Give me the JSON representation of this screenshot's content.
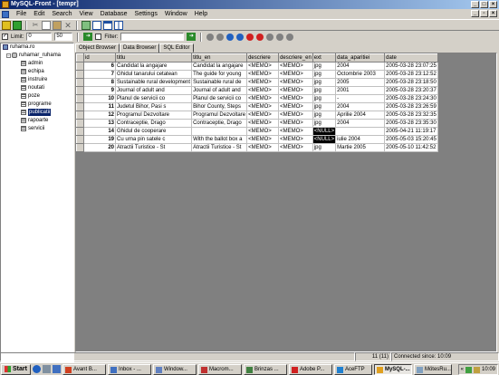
{
  "window": {
    "title": "MySQL-Front - [tempr]"
  },
  "menu": [
    "File",
    "Edit",
    "Search",
    "View",
    "Database",
    "Settings",
    "Window",
    "Help"
  ],
  "toolbar2": {
    "limit_label": "Limit:",
    "limit_from": "0",
    "limit_count": "50",
    "filter_label": "Filter:",
    "filter_value": ""
  },
  "tree": {
    "server": "ruhama.ro",
    "database": "ruhamar_ruhama",
    "tables": [
      "admin",
      "echipa",
      "instruire",
      "noutati",
      "poze",
      "programe",
      "publicatii",
      "rapoarte",
      "servicii"
    ],
    "selected": "publicatii"
  },
  "tabs": [
    "Object Browser",
    "Data Browser",
    "SQL Editor"
  ],
  "grid": {
    "columns": [
      "id",
      "titlu",
      "titlu_en",
      "descriere",
      "descriere_en",
      "ext",
      "data_aparitiei",
      "date"
    ],
    "rows": [
      [
        "6",
        "Candidat la angajare",
        "Candidat la angajare",
        "<MEMO>",
        "<MEMO>",
        "jpg",
        "2004",
        "2005-03-28 23:07:25"
      ],
      [
        "7",
        "Ghidul tanarului cetatean",
        "The guide for young",
        "<MEMO>",
        "<MEMO>",
        "jpg",
        "Octombrie 2003",
        "2005-03-28 23:12:52"
      ],
      [
        "8",
        "Sustainable rural development",
        "Sustainable rural de",
        "<MEMO>",
        "<MEMO>",
        "jpg",
        "2005",
        "2005-03-28 23:18:50"
      ],
      [
        "9",
        "Journal of adult and",
        "Journal of adult and",
        "<MEMO>",
        "<MEMO>",
        "jpg",
        "2001",
        "2005-03-28 23:20:37"
      ],
      [
        "10",
        "Planul de servicii co",
        "Planul de servicii co",
        "<MEMO>",
        "<MEMO>",
        "jpg",
        "-",
        "2005-03-28 23:24:30"
      ],
      [
        "11",
        "Judetul Bihor, Pasi s",
        "Bihor County, Steps",
        "<MEMO>",
        "<MEMO>",
        "jpg",
        "2004",
        "2005-03-28 23:26:59"
      ],
      [
        "12",
        "Programul Dezvoltare",
        "Programul Dezvoltare",
        "<MEMO>",
        "<MEMO>",
        "jpg",
        "Aprilie 2004",
        "2005-03-28 23:32:35"
      ],
      [
        "13",
        "Contraceptie, Drago",
        "Contraceptie, Drago",
        "<MEMO>",
        "<MEMO>",
        "jpg",
        "2004",
        "2005-03-28 23:35:30"
      ],
      [
        "14",
        "Ghidul de cooperare",
        "",
        "<MEMO>",
        "<MEMO>",
        "<NULL>",
        "",
        "2005-04-21 11:19:17"
      ],
      [
        "19",
        "Cu urna pin satele c",
        "With the ballot box a",
        "<MEMO>",
        "<MEMO>",
        "<NULL>",
        "iulie 2004",
        "2005-05-03 15:20:45"
      ],
      [
        "20",
        "Atractii Turistice - St",
        "Atractii Turistice - St",
        "<MEMO>",
        "<MEMO>",
        "jpg",
        "Martie 2005",
        "2005-05-10 11:42:52"
      ]
    ]
  },
  "status": {
    "count": "11 (11)",
    "connection": "Connected since: 10:09"
  },
  "taskbar": {
    "start": "Start",
    "tasks": [
      "Avant B...",
      "Inbox - ...",
      "Window...",
      "Macrom...",
      "Brinzas ...",
      "Adobe P...",
      "AceFTP",
      "MySQL-...",
      "MötesRu..."
    ],
    "active_task": "MySQL-...",
    "clock": "10:09"
  },
  "colors": {
    "title_start": "#0a246a",
    "title_end": "#a6caf0",
    "selection": "#0a246a",
    "face": "#d4d0c8"
  }
}
